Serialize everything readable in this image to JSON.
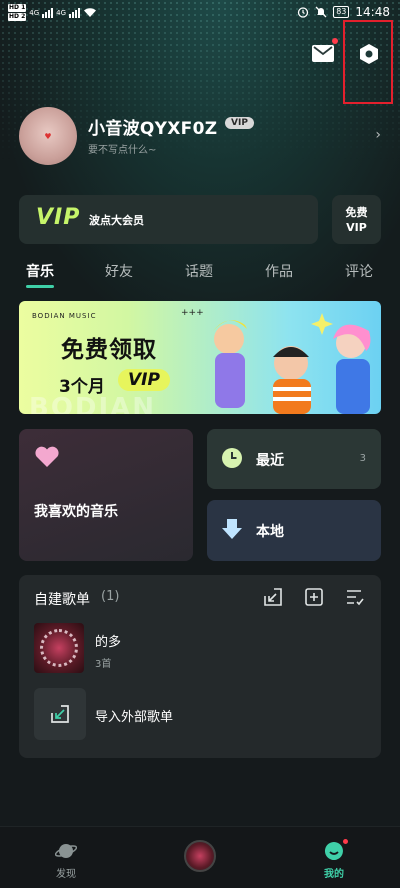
{
  "status_bar": {
    "sim1": "HD 1",
    "sim2": "HD 2",
    "network1": "4G",
    "network2": "4G",
    "battery": "83",
    "time": "14:48"
  },
  "header": {
    "mail_icon": "mail-icon",
    "settings_icon": "settings-icon"
  },
  "profile": {
    "username": "小音波QYXF0Z",
    "vip_badge": "VIP",
    "bio": "要不写点什么~"
  },
  "vip_banner": {
    "vip_word": "VIP",
    "label": "波点大会员",
    "free_vip_line1": "免费",
    "free_vip_line2": "VIP"
  },
  "tabs": [
    {
      "label": "音乐",
      "active": true
    },
    {
      "label": "好友",
      "active": false
    },
    {
      "label": "话题",
      "active": false
    },
    {
      "label": "作品",
      "active": false
    },
    {
      "label": "评论",
      "active": false
    }
  ],
  "promo": {
    "brand": "BODIAN MUSIC",
    "decoration": "+++",
    "title": "免费领取",
    "months": "3个月",
    "vip": "VIP",
    "watermark": "BODIAN"
  },
  "cards": {
    "favorites_label": "我喜欢的音乐",
    "recent_label": "最近",
    "recent_count": "3",
    "local_label": "本地"
  },
  "playlist_section": {
    "title": "自建歌单",
    "count": "(1)",
    "items": [
      {
        "name": "的多",
        "songs": "3首"
      }
    ],
    "import_label": "导入外部歌单"
  },
  "bottom_nav": [
    {
      "label": "发现",
      "active": false
    },
    {
      "label": "",
      "active": false
    },
    {
      "label": "我的",
      "active": true
    }
  ],
  "colors": {
    "accent": "#3fd0a8",
    "vip_green": "#c6f56a",
    "badge_red": "#ff3b4a",
    "highlight_red": "#e3202d"
  }
}
